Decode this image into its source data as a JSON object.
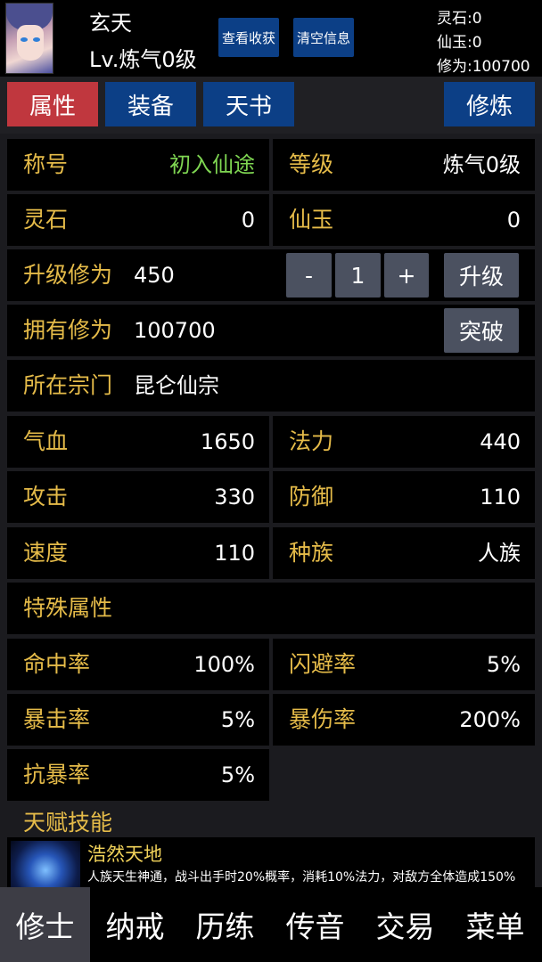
{
  "header": {
    "name": "玄天",
    "level": "Lv.炼气0级",
    "btn_view_income": "查看收获",
    "btn_clear_info": "清空信息",
    "resources": [
      "灵石:0",
      "仙玉:0",
      "修为:100700"
    ]
  },
  "tabs": {
    "attributes": "属性",
    "equipment": "装备",
    "heaven_book": "天书",
    "cultivate": "修炼"
  },
  "stats": {
    "title_label": "称号",
    "title_value": "初入仙途",
    "level_label": "等级",
    "level_value": "炼气0级",
    "spirit_stone_label": "灵石",
    "spirit_stone_value": "0",
    "jade_label": "仙玉",
    "jade_value": "0",
    "upgrade_xp_label": "升级修为",
    "upgrade_xp_value": "450",
    "stepper_minus": "-",
    "stepper_value": "1",
    "stepper_plus": "+",
    "upgrade_btn": "升级",
    "owned_xp_label": "拥有修为",
    "owned_xp_value": "100700",
    "breakthrough_btn": "突破",
    "sect_label": "所在宗门",
    "sect_value": "昆仑仙宗",
    "hp_label": "气血",
    "hp_value": "1650",
    "mana_label": "法力",
    "mana_value": "440",
    "atk_label": "攻击",
    "atk_value": "330",
    "def_label": "防御",
    "def_value": "110",
    "speed_label": "速度",
    "speed_value": "110",
    "race_label": "种族",
    "race_value": "人族",
    "special_label": "特殊属性",
    "hit_label": "命中率",
    "hit_value": "100%",
    "dodge_label": "闪避率",
    "dodge_value": "5%",
    "crit_label": "暴击率",
    "crit_value": "5%",
    "crit_dmg_label": "暴伤率",
    "crit_dmg_value": "200%",
    "anti_crit_label": "抗暴率",
    "anti_crit_value": "5%"
  },
  "talent": {
    "section_title": "天赋技能",
    "name": "浩然天地",
    "desc": "人族天生神通，战斗出手时20%概率，消耗10%法力，对敌方全体造成150%"
  },
  "bottom_nav": [
    "修士",
    "纳戒",
    "历练",
    "传音",
    "交易",
    "菜单"
  ],
  "colors": {
    "label": "#e5bb49",
    "green": "#7fd652",
    "tab_blue": "#0c3f86",
    "tab_active": "#c0373e",
    "button_gray": "#4b5160"
  }
}
